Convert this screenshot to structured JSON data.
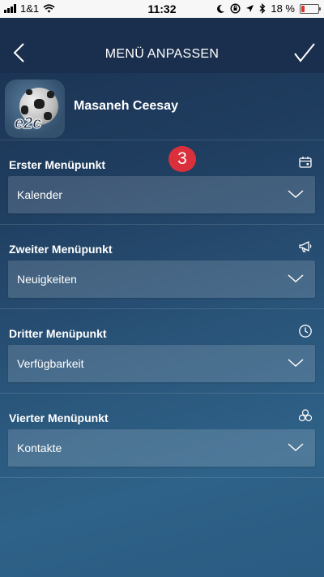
{
  "status_bar": {
    "carrier": "1&1",
    "time": "11:32",
    "battery_text": "18 %",
    "battery_level": 0.18
  },
  "nav": {
    "title": "MENÜ ANPASSEN",
    "back_icon": "chevron-left-icon",
    "done_icon": "checkmark-icon"
  },
  "profile": {
    "name": "Masaneh Ceesay",
    "avatar_text": "e2c"
  },
  "step_badge": "3",
  "sections": [
    {
      "label": "Erster Menüpunkt",
      "icon": "calendar-icon",
      "value": "Kalender"
    },
    {
      "label": "Zweiter Menüpunkt",
      "icon": "megaphone-icon",
      "value": "Neuigkeiten"
    },
    {
      "label": "Dritter Menüpunkt",
      "icon": "clock-icon",
      "value": "Verfügbarkeit"
    },
    {
      "label": "Vierter Menüpunkt",
      "icon": "contacts-icon",
      "value": "Kontakte"
    }
  ],
  "colors": {
    "nav_bg": "#1a2f4d",
    "badge": "#d9303c",
    "battery_low": "#e0302a"
  }
}
